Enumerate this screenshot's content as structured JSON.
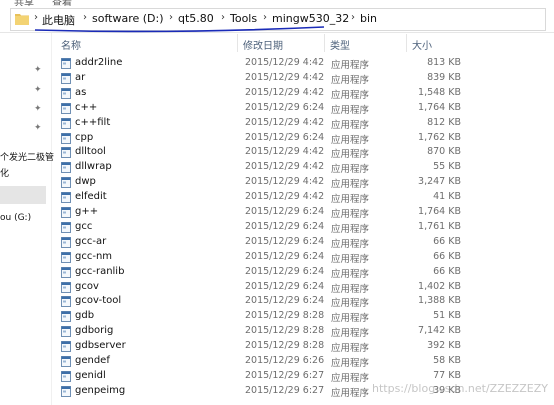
{
  "menu": {
    "items": [
      "共享",
      "查看"
    ]
  },
  "breadcrumb": [
    "此电脑",
    "software (D:)",
    "qt5.80",
    "Tools",
    "mingw530_32",
    "bin"
  ],
  "nav": {
    "pins": 5,
    "partial_1": "个发光二极管",
    "partial_2": "化",
    "partial_3": "ou (G:)"
  },
  "columns": {
    "name": "名称",
    "date": "修改日期",
    "type": "类型",
    "size": "大小"
  },
  "files": [
    {
      "name": "addr2line",
      "date": "2015/12/29 4:42",
      "type": "应用程序",
      "size": "813 KB"
    },
    {
      "name": "ar",
      "date": "2015/12/29 4:42",
      "type": "应用程序",
      "size": "839 KB"
    },
    {
      "name": "as",
      "date": "2015/12/29 4:42",
      "type": "应用程序",
      "size": "1,548 KB"
    },
    {
      "name": "c++",
      "date": "2015/12/29 6:24",
      "type": "应用程序",
      "size": "1,764 KB"
    },
    {
      "name": "c++filt",
      "date": "2015/12/29 4:42",
      "type": "应用程序",
      "size": "812 KB"
    },
    {
      "name": "cpp",
      "date": "2015/12/29 6:24",
      "type": "应用程序",
      "size": "1,762 KB"
    },
    {
      "name": "dlltool",
      "date": "2015/12/29 4:42",
      "type": "应用程序",
      "size": "870 KB"
    },
    {
      "name": "dllwrap",
      "date": "2015/12/29 4:42",
      "type": "应用程序",
      "size": "55 KB"
    },
    {
      "name": "dwp",
      "date": "2015/12/29 4:42",
      "type": "应用程序",
      "size": "3,247 KB"
    },
    {
      "name": "elfedit",
      "date": "2015/12/29 4:42",
      "type": "应用程序",
      "size": "41 KB"
    },
    {
      "name": "g++",
      "date": "2015/12/29 6:24",
      "type": "应用程序",
      "size": "1,764 KB"
    },
    {
      "name": "gcc",
      "date": "2015/12/29 6:24",
      "type": "应用程序",
      "size": "1,761 KB"
    },
    {
      "name": "gcc-ar",
      "date": "2015/12/29 6:24",
      "type": "应用程序",
      "size": "66 KB"
    },
    {
      "name": "gcc-nm",
      "date": "2015/12/29 6:24",
      "type": "应用程序",
      "size": "66 KB"
    },
    {
      "name": "gcc-ranlib",
      "date": "2015/12/29 6:24",
      "type": "应用程序",
      "size": "66 KB"
    },
    {
      "name": "gcov",
      "date": "2015/12/29 6:24",
      "type": "应用程序",
      "size": "1,402 KB"
    },
    {
      "name": "gcov-tool",
      "date": "2015/12/29 6:24",
      "type": "应用程序",
      "size": "1,388 KB"
    },
    {
      "name": "gdb",
      "date": "2015/12/29 8:28",
      "type": "应用程序",
      "size": "51 KB"
    },
    {
      "name": "gdborig",
      "date": "2015/12/29 8:28",
      "type": "应用程序",
      "size": "7,142 KB"
    },
    {
      "name": "gdbserver",
      "date": "2015/12/29 8:28",
      "type": "应用程序",
      "size": "392 KB"
    },
    {
      "name": "gendef",
      "date": "2015/12/29 6:26",
      "type": "应用程序",
      "size": "58 KB"
    },
    {
      "name": "genidl",
      "date": "2015/12/29 6:27",
      "type": "应用程序",
      "size": "77 KB"
    },
    {
      "name": "genpeimg",
      "date": "2015/12/29 6:27",
      "type": "应用程序",
      "size": "39 KB"
    }
  ],
  "watermark": "https://blog.csdn.net/ZZEZZEZY",
  "colors": {
    "underline": "#1a2bb8",
    "folder": "#e8c15a",
    "header_text": "#4c607a"
  }
}
